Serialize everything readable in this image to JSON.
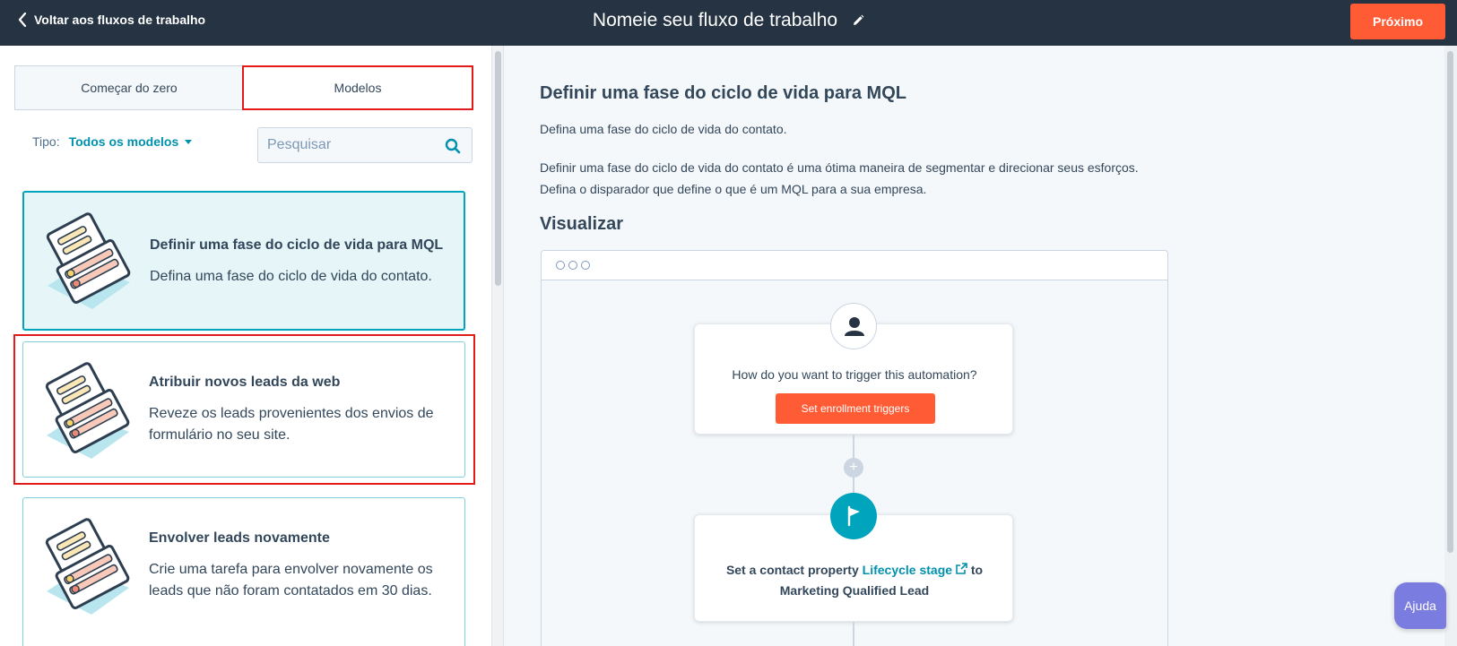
{
  "topbar": {
    "back_label": "Voltar aos fluxos de trabalho",
    "title": "Nomeie seu fluxo de trabalho",
    "next_label": "Próximo"
  },
  "tabs": [
    {
      "label": "Começar do zero",
      "active": false
    },
    {
      "label": "Modelos",
      "active": true
    }
  ],
  "filter": {
    "type_label": "Tipo:",
    "type_value": "Todos os modelos"
  },
  "search": {
    "placeholder": "Pesquisar",
    "value": ""
  },
  "templates": [
    {
      "title": "Definir uma fase do ciclo de vida para MQL",
      "description": "Defina uma fase do ciclo de vida do contato.",
      "selected": true
    },
    {
      "title": "Atribuir novos leads da web",
      "description": "Reveze os leads provenientes dos envios de formulário no seu site.",
      "selected": false
    },
    {
      "title": "Envolver leads novamente",
      "description": "Crie uma tarefa para envolver novamente os leads que não foram contatados em 30 dias.",
      "selected": false
    }
  ],
  "detail": {
    "title": "Definir uma fase do ciclo de vida para MQL",
    "subtitle": "Defina uma fase do ciclo de vida do contato.",
    "para_line1": "Definir uma fase do ciclo de vida do contato é uma ótima maneira de segmentar e direcionar seus esforços.",
    "para_line2": "Defina o disparador que define o que é um MQL para a sua empresa.",
    "visualize_heading": "Visualizar"
  },
  "preview": {
    "trigger_question": "How do you want to trigger this automation?",
    "trigger_button": "Set enrollment triggers",
    "action_prefix": "Set a contact property",
    "action_link": "Lifecycle stage",
    "action_suffix": "to",
    "action_value": "Marketing Qualified Lead"
  },
  "help_label": "Ajuda",
  "colors": {
    "topbar": "#253342",
    "primary_orange": "#ff5c35",
    "teal": "#00a4bd",
    "link": "#0091ae",
    "highlight_red": "#e31a1a",
    "help_purple": "#7b7cdf"
  }
}
